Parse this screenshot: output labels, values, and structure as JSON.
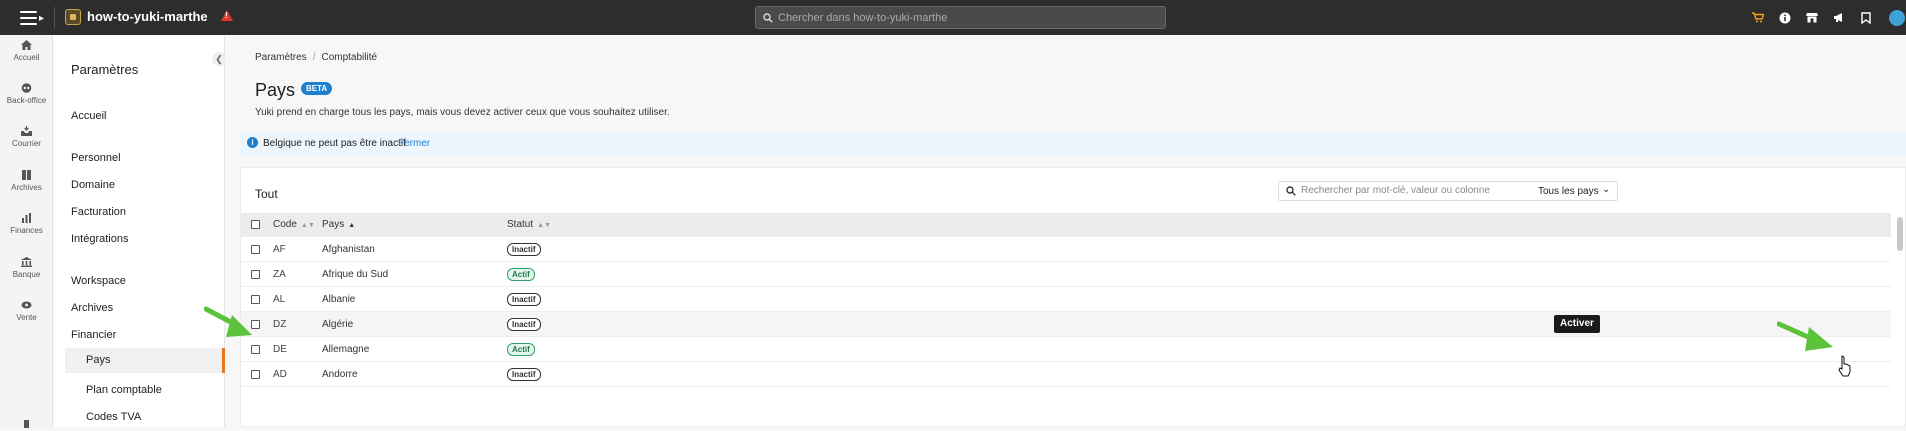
{
  "topbar": {
    "app_name": "how-to-yuki-marthe",
    "search_placeholder": "Chercher dans how-to-yuki-marthe",
    "icons": [
      "cart-icon",
      "info-icon",
      "store-icon",
      "megaphone-icon",
      "bookmark-icon",
      "user-avatar-icon"
    ],
    "colors": {
      "bar": "#2d2d2d",
      "warning": "#e0392b",
      "cart": "#f0a020"
    }
  },
  "rail": {
    "items": [
      {
        "label": "Accueil",
        "icon": "home-icon"
      },
      {
        "label": "Back-office",
        "icon": "backoffice-icon"
      },
      {
        "label": "Courrier",
        "icon": "mail-tray-icon"
      },
      {
        "label": "Archives",
        "icon": "archives-icon"
      },
      {
        "label": "Finances",
        "icon": "finance-chart-icon"
      },
      {
        "label": "Banque",
        "icon": "bank-icon"
      },
      {
        "label": "Vente",
        "icon": "sales-icon"
      }
    ]
  },
  "settings_nav": {
    "title": "Paramètres",
    "items": [
      "Accueil",
      "Personnel",
      "Domaine",
      "Facturation",
      "Intégrations",
      "Workspace",
      "Archives",
      "Financier"
    ],
    "sub_items": [
      "Pays",
      "Plan comptable",
      "Codes TVA"
    ],
    "active": "Pays",
    "accent": "#e87722"
  },
  "breadcrumb": {
    "parent": "Paramètres",
    "current": "Comptabilité"
  },
  "page": {
    "title": "Pays",
    "badge": "BETA",
    "description": "Yuki prend en charge tous les pays, mais vous devez activer ceux que vous souhaitez utiliser."
  },
  "toast": {
    "message": "Belgique ne peut pas être inactif",
    "close_label": "Fermer"
  },
  "panel": {
    "title": "Tout",
    "search_placeholder": "Rechercher par mot-clé, valeur ou colonne",
    "filter_label": "Tous les pays"
  },
  "table": {
    "columns": {
      "code": "Code",
      "country": "Pays",
      "status": "Statut"
    },
    "rows": [
      {
        "code": "AF",
        "country": "Afghanistan",
        "status": "Inactif",
        "active": false
      },
      {
        "code": "ZA",
        "country": "Afrique du Sud",
        "status": "Actif",
        "active": true
      },
      {
        "code": "AL",
        "country": "Albanie",
        "status": "Inactif",
        "active": false
      },
      {
        "code": "DZ",
        "country": "Algérie",
        "status": "Inactif",
        "active": false
      },
      {
        "code": "DE",
        "country": "Allemagne",
        "status": "Actif",
        "active": true
      },
      {
        "code": "AD",
        "country": "Andorre",
        "status": "Inactif",
        "active": false
      }
    ],
    "row_action_label": "Activer"
  }
}
